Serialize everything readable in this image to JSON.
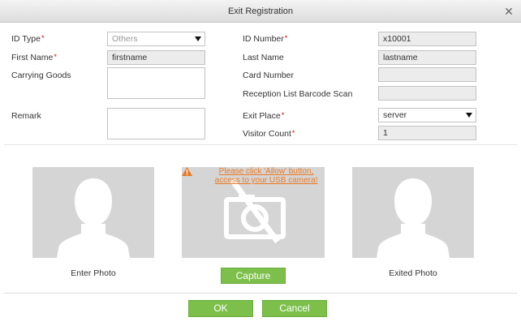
{
  "dialog": {
    "title": "Exit Registration",
    "close_icon": "close-icon"
  },
  "form": {
    "id_type": {
      "label": "ID Type",
      "value": "Others"
    },
    "first_name": {
      "label": "First Name",
      "value": "firstname"
    },
    "carrying_goods": {
      "label": "Carrying Goods",
      "value": ""
    },
    "remark": {
      "label": "Remark",
      "value": ""
    },
    "id_number": {
      "label": "ID Number",
      "value": "x10001"
    },
    "last_name": {
      "label": "Last Name",
      "value": "lastname"
    },
    "card_number": {
      "label": "Card Number",
      "value": ""
    },
    "barcode_scan": {
      "label": "Reception List Barcode Scan",
      "value": ""
    },
    "exit_place": {
      "label": "Exit Place",
      "value": "server"
    },
    "visitor_count": {
      "label": "Visitor Count",
      "value": "1"
    },
    "required_mark": "*"
  },
  "photos": {
    "enter_label": "Enter Photo",
    "exited_label": "Exited Photo",
    "camera_warning": "Please click 'Allow' button, access to your USB camera!",
    "capture_label": "Capture"
  },
  "footer": {
    "ok_label": "OK",
    "cancel_label": "Cancel"
  },
  "colors": {
    "accent_green": "#7cc04b",
    "warning_orange": "#e87a26",
    "required_red": "#e00000"
  }
}
